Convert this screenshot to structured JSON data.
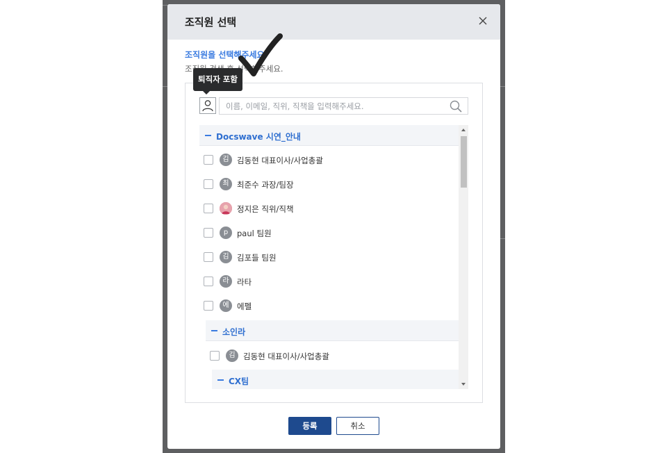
{
  "modal": {
    "title": "조직원 선택",
    "guide_primary": "조직원을 선택해주세요.",
    "guide_secondary": "조직원 검색 후 선택해주세요.",
    "close_icon": "close-icon"
  },
  "tooltip": {
    "text": "퇴직자 포함"
  },
  "search": {
    "placeholder": "이름, 이메일, 직위, 직책을 입력해주세요.",
    "value": ""
  },
  "tree": {
    "root_group": "Docswave 시연_안내",
    "members": [
      {
        "avatar": "김",
        "name": "김동현 대표이사/사업총괄"
      },
      {
        "avatar": "최",
        "name": "최준수 과장/팀장"
      },
      {
        "avatar": "",
        "name": "정지은 직위/직책"
      },
      {
        "avatar": "p",
        "name": "paul 팀원"
      },
      {
        "avatar": "김",
        "name": "김포들 팀원"
      },
      {
        "avatar": "라",
        "name": "라타"
      },
      {
        "avatar": "에",
        "name": "에펠"
      }
    ],
    "sub_group": "소인라",
    "sub_members": [
      {
        "avatar": "김",
        "name": "김동현 대표이사/사업총괄"
      }
    ],
    "sub_sub_group": "CX팀"
  },
  "buttons": {
    "register": "등록",
    "cancel": "취소"
  },
  "colors": {
    "accent": "#3a7be0",
    "primary_button": "#1e4a8e",
    "header_bg": "#e6e8ec"
  }
}
